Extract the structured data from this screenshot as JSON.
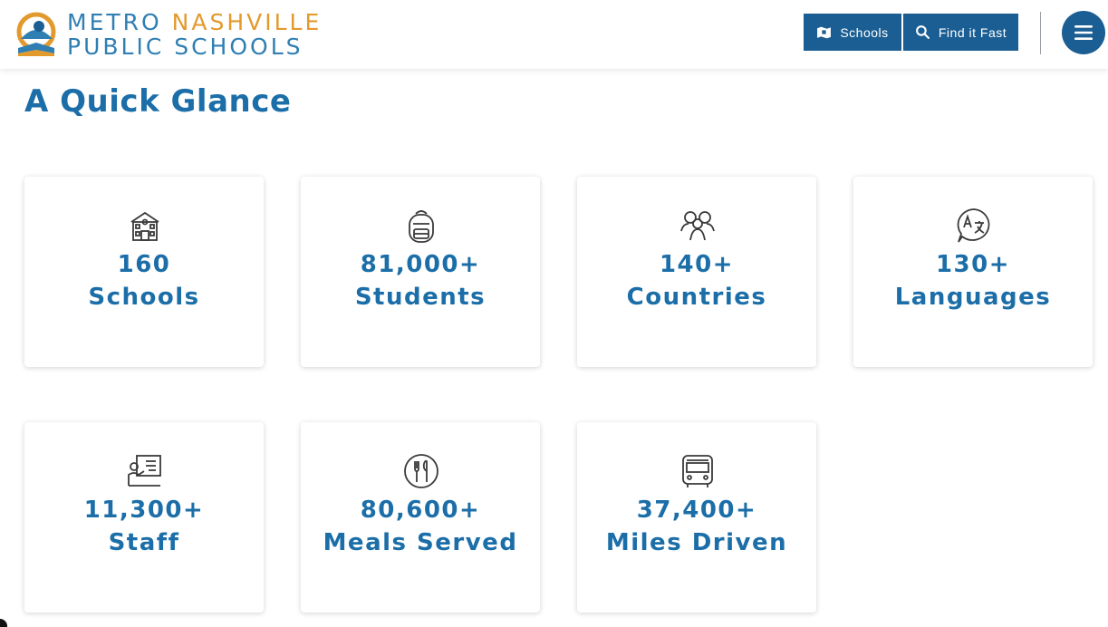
{
  "header": {
    "logo": {
      "line1_part1": "METRO",
      "line1_part2": "NASHVILLE",
      "line2": "PUBLIC SCHOOLS"
    },
    "schools_button": "Schools",
    "find_button": "Find it Fast"
  },
  "page_title": "A Quick Glance",
  "stats": [
    {
      "value": "160",
      "label": "Schools",
      "icon": "school-building-icon"
    },
    {
      "value": "81,000+",
      "label": "Students",
      "icon": "backpack-icon"
    },
    {
      "value": "140+",
      "label": "Countries",
      "icon": "people-icon"
    },
    {
      "value": "130+",
      "label": "Languages",
      "icon": "translate-icon"
    },
    {
      "value": "11,300+",
      "label": "Staff",
      "icon": "teacher-board-icon"
    },
    {
      "value": "80,600+",
      "label": "Meals Served",
      "icon": "plate-utensils-icon"
    },
    {
      "value": "37,400+",
      "label": "Miles Driven",
      "icon": "bus-icon"
    }
  ],
  "colors": {
    "brand_blue": "#1b5e93",
    "heading_blue": "#1b6ea8",
    "logo_orange": "#e39a2d"
  }
}
